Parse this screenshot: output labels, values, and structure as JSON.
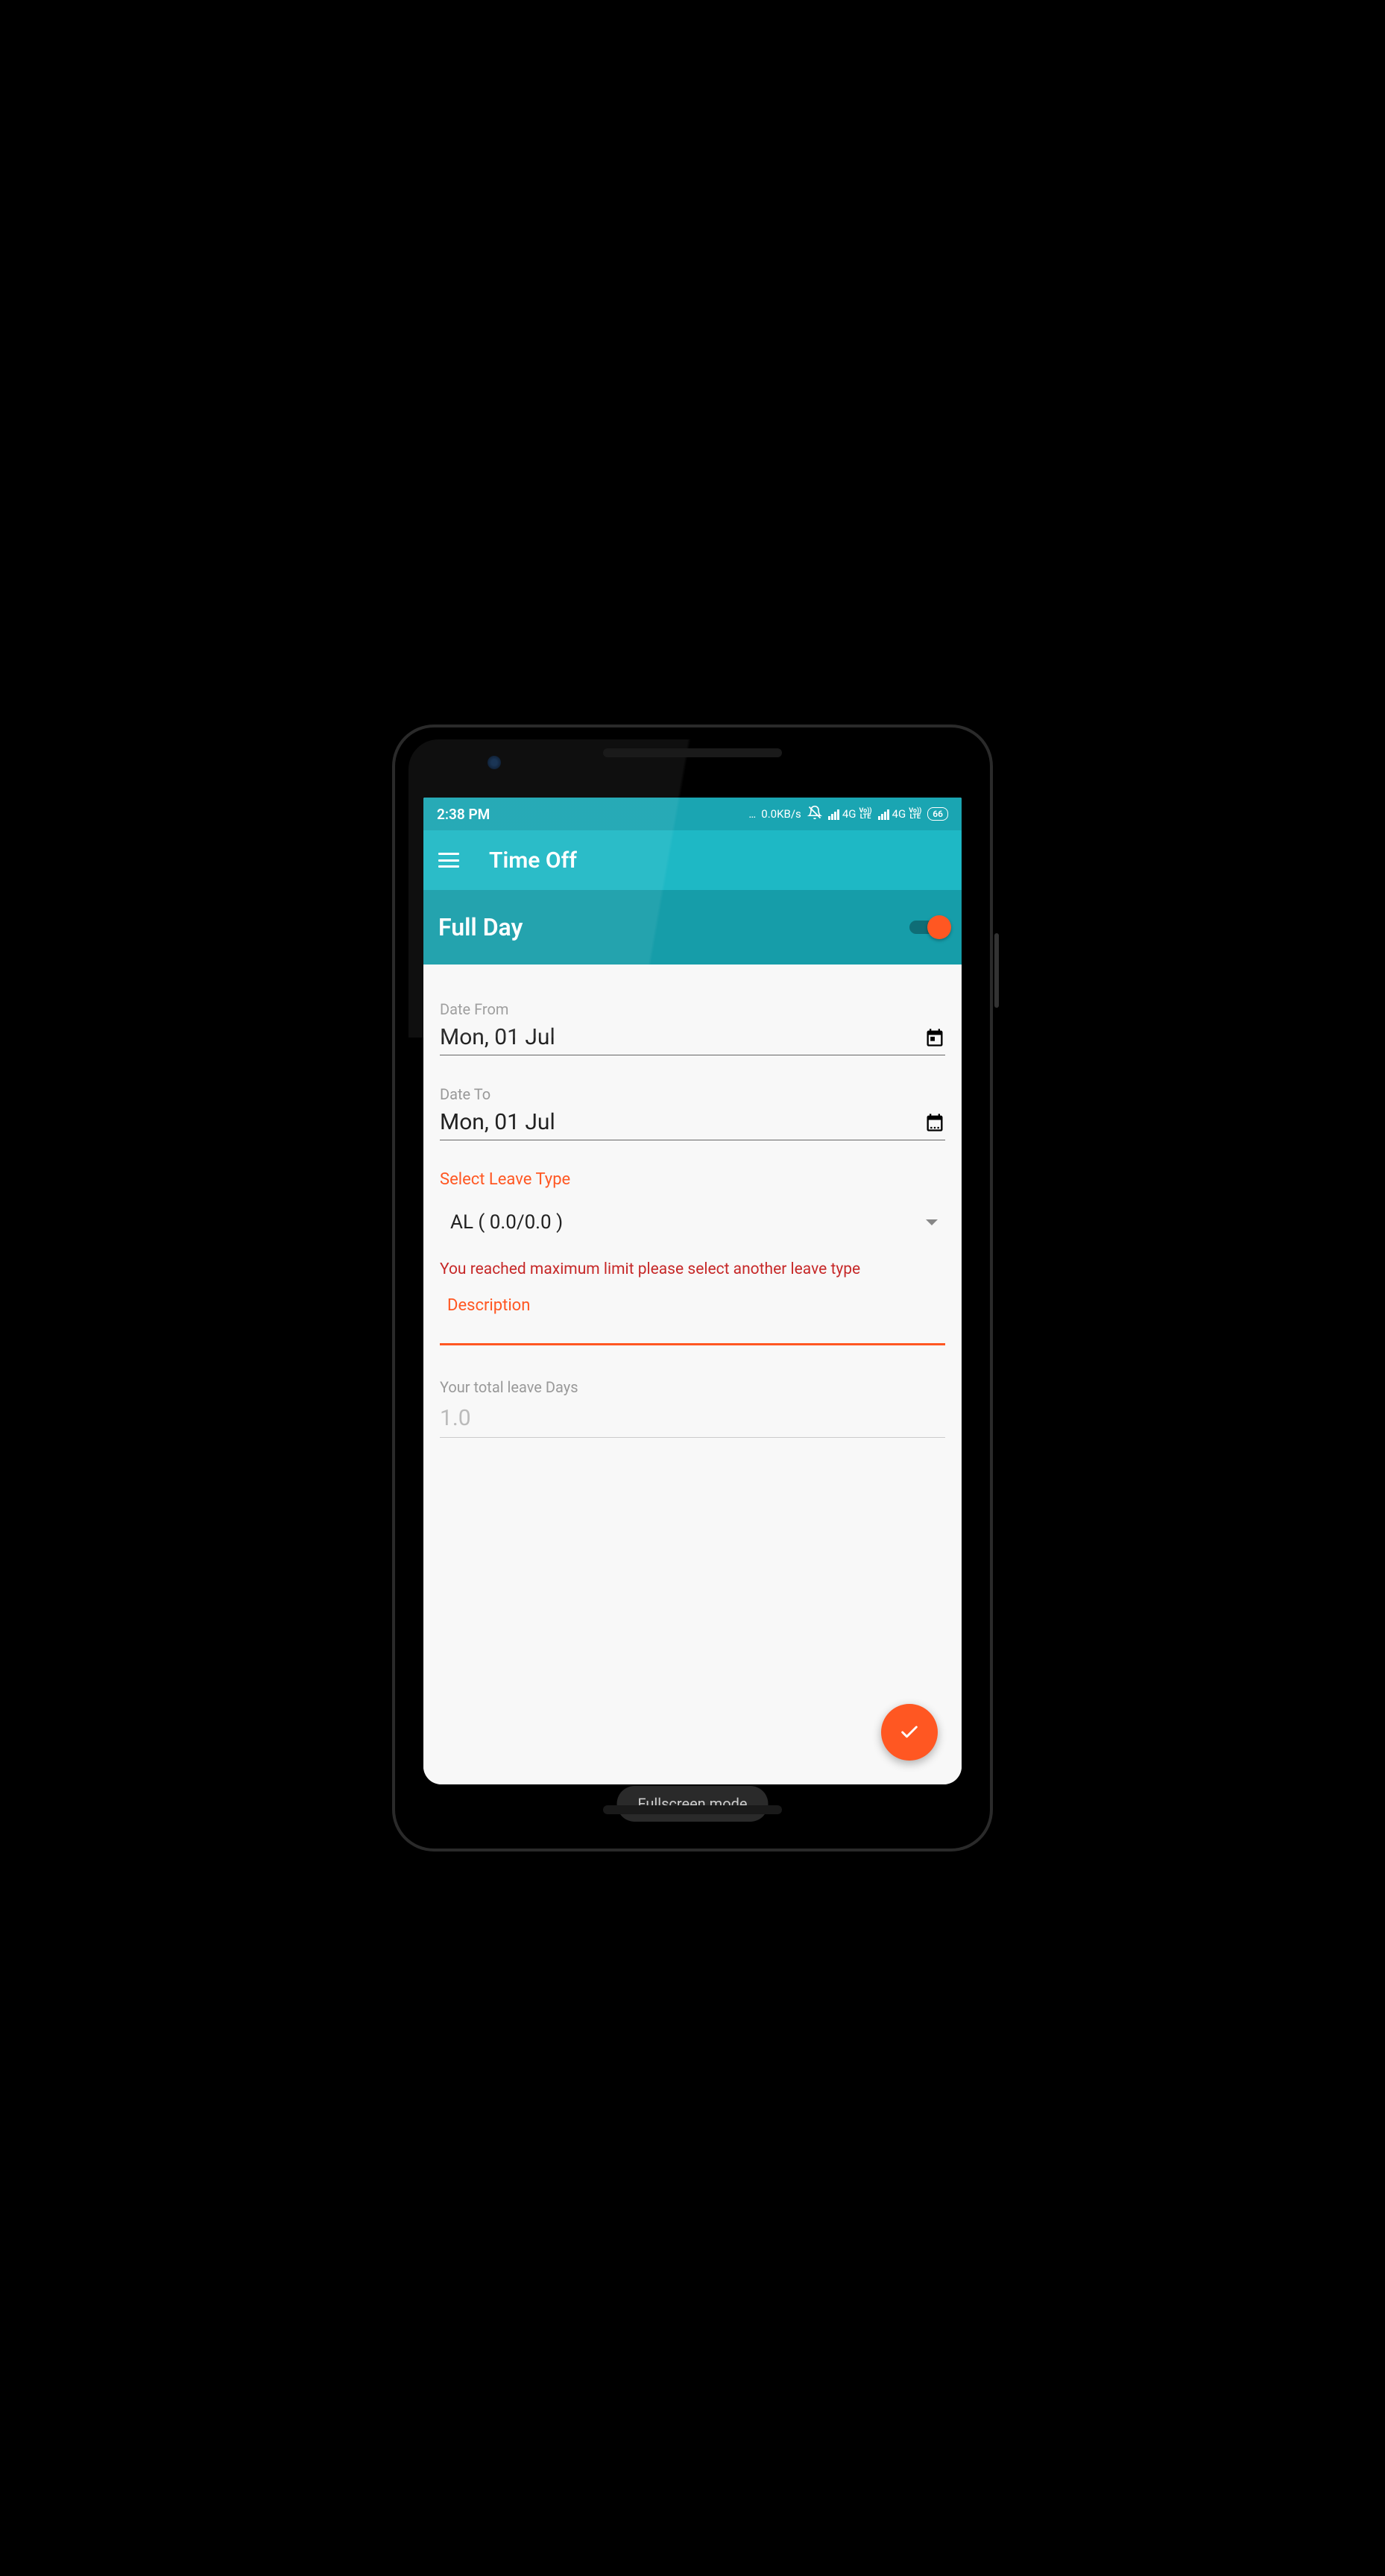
{
  "statusBar": {
    "time": "2:38 PM",
    "dataRate": "0.0KB/s",
    "network1": "4G",
    "network2": "4G",
    "volte": "Vo LTE",
    "battery": "66"
  },
  "appBar": {
    "title": "Time Off"
  },
  "toggleSection": {
    "label": "Full Day",
    "enabled": true
  },
  "form": {
    "dateFrom": {
      "label": "Date From",
      "value": "Mon, 01 Jul"
    },
    "dateTo": {
      "label": "Date To",
      "value": "Mon, 01 Jul"
    },
    "leaveTypeLabel": "Select Leave Type",
    "leaveTypeValue": "AL ( 0.0/0.0 )",
    "errorMessage": "You reached maximum limit please select another leave type",
    "descriptionLabel": "Description",
    "descriptionValue": "",
    "totalDaysLabel": "Your total leave Days",
    "totalDaysValue": "1.0"
  },
  "fullscreenText": "Fullscreen mode",
  "colors": {
    "primary": "#1eb8c5",
    "primaryDark": "#169da9",
    "accent": "#ff5722",
    "error": "#c62828"
  }
}
